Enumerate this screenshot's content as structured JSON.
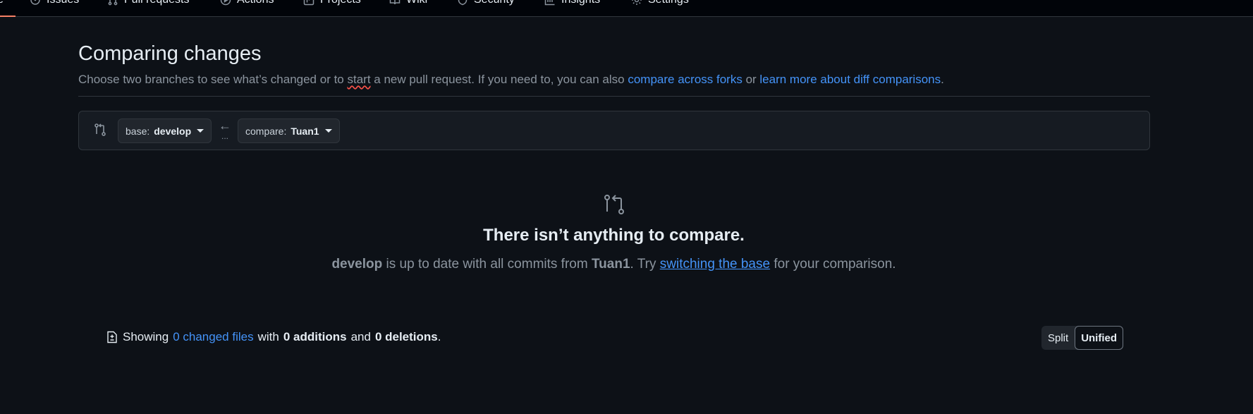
{
  "repo_nav": {
    "tabs": [
      {
        "label": "Issues",
        "icon": "issue-icon"
      },
      {
        "label": "Pull requests",
        "icon": "pull-request-icon"
      },
      {
        "label": "Actions",
        "icon": "actions-icon"
      },
      {
        "label": "Projects",
        "icon": "projects-icon"
      },
      {
        "label": "Wiki",
        "icon": "wiki-icon"
      },
      {
        "label": "Security",
        "icon": "shield-icon"
      },
      {
        "label": "Insights",
        "icon": "graph-icon"
      },
      {
        "label": "Settings",
        "icon": "gear-icon"
      }
    ],
    "active_tab_fragment": "e",
    "accent_color": "#f78166"
  },
  "header": {
    "title": "Comparing changes",
    "subtitle_prefix": "Choose two branches to see what’s changed or to ",
    "subtitle_start": "start",
    "subtitle_middle": " a new pull request. If you need to, you can also ",
    "compare_forks_link": "compare across forks",
    "subtitle_or": " or ",
    "learn_more_link": "learn more about diff comparisons",
    "subtitle_end": "."
  },
  "range": {
    "base_label": "base:",
    "base_value": "develop",
    "compare_label": "compare:",
    "compare_value": "Tuan1",
    "arrow": "←",
    "dots": "..."
  },
  "blankslate": {
    "title": "There isn’t anything to compare.",
    "branch_base": "develop",
    "text_1": " is up to date with all commits from ",
    "branch_compare": "Tuan1",
    "text_2": ". Try ",
    "switch_link": "switching the base",
    "text_3": " for your comparison."
  },
  "diff_stats": {
    "showing": "Showing",
    "files_link": "0 changed files",
    "with": "with",
    "additions": "0 additions",
    "and": "and",
    "deletions": "0 deletions",
    "period": "."
  },
  "view_toggle": {
    "split": "Split",
    "unified": "Unified",
    "selected": "Unified"
  },
  "colors": {
    "background": "#0d1117",
    "link": "#4493f8",
    "muted": "#8b949e",
    "border": "#30363d"
  }
}
